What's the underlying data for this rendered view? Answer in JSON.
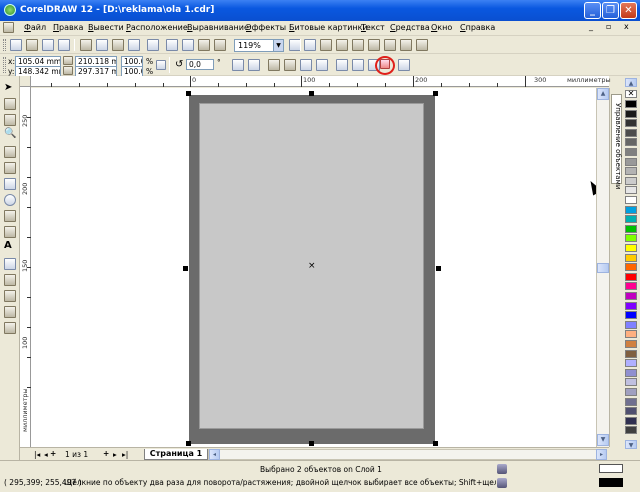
{
  "window": {
    "title": "CorelDRAW 12 - [D:\\reklama\\ola 1.cdr]",
    "minimize": "_",
    "restore": "❐",
    "close": "✕"
  },
  "menu": [
    "Файл",
    "Правка",
    "Вывести",
    "Расположение",
    "Выравнивание",
    "Эффекты",
    "Битовые картинки",
    "Текст",
    "Средства",
    "Окно",
    "Справка"
  ],
  "toolbar": {
    "zoom": "119%"
  },
  "propertybar": {
    "x_label": "x:",
    "y_label": "y:",
    "x": "105.04 mm",
    "y": "148.342 mm",
    "width": "210.118 m",
    "height": "297.317 m",
    "scale_x": "100.0",
    "scale_y": "100.0",
    "percent": "%",
    "rotation": "0,0",
    "degree": "°"
  },
  "ruler": {
    "units": "миллиметры",
    "h_ticks": [
      "0",
      "100",
      "200",
      "300"
    ],
    "v_ticks": [
      "250",
      "200",
      "150",
      "100",
      "50"
    ],
    "v_units": "миллиметры"
  },
  "docker": {
    "tab_label": "Управление объектами"
  },
  "page_nav": {
    "first": "|◂",
    "prev": "◂",
    "add_before": "+",
    "position": "1 из 1",
    "add_after": "+",
    "next": "▸",
    "last": "▸|",
    "page_tab": "Страница 1"
  },
  "status": {
    "selection": "Выбрано 2 объектов on Слой 1",
    "coords": "( 295,399; 255,497 )",
    "hint": "Щёлкние по объекту два раза для поворота/растяжения; двойной щелчок выбирает все объекты; Shift+щелчок - выбор не..."
  },
  "palette_colors": [
    "#ffffff",
    "#000000",
    "#1a1a1a",
    "#333333",
    "#4d4d4d",
    "#666666",
    "#808080",
    "#999999",
    "#b3b3b3",
    "#cccccc",
    "#e6e6e6",
    "#ffffff",
    "#00a0e0",
    "#00b0b0",
    "#00c000",
    "#7fff00",
    "#ffff00",
    "#ffcc00",
    "#ff6600",
    "#ff0000",
    "#ff0090",
    "#c000c0",
    "#8000ff",
    "#0000ff",
    "#8080ff",
    "#ffb080",
    "#d08040",
    "#806040",
    "#b0b0ff",
    "#9090d0",
    "#c0c0e0",
    "#a0a0c0",
    "#707090",
    "#505070",
    "#303050",
    "#404040"
  ]
}
